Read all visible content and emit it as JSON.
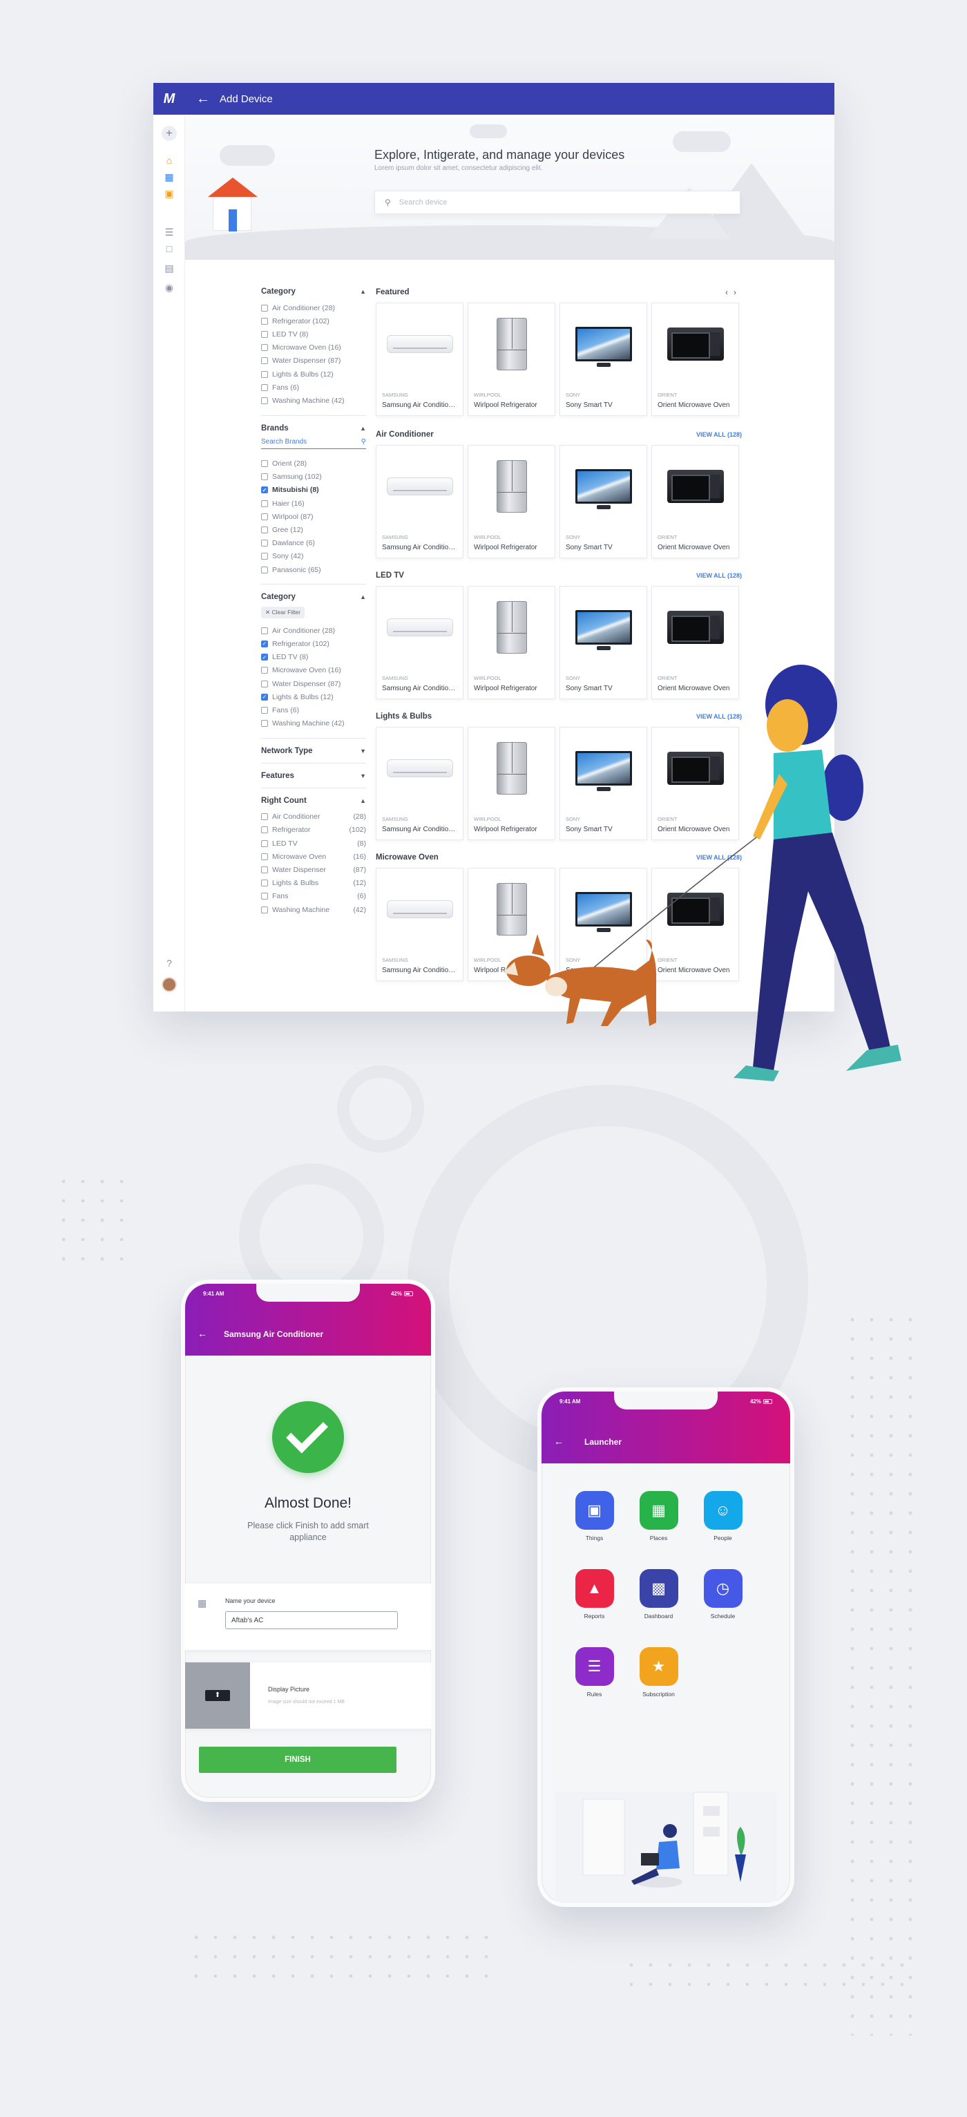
{
  "colors": {
    "primary": "#3a3fb0",
    "accent_blue": "#3b7ee8",
    "mobile_gradient_start": "#8b1eb7",
    "mobile_gradient_end": "#d4117a",
    "success": "#3bb54a"
  },
  "desktop": {
    "logo": "M",
    "title": "Add Device",
    "sidebar_icons": [
      "plus-icon",
      "home-icon",
      "devices-icon",
      "image-icon",
      "layers-icon",
      "calendar-icon",
      "document-icon",
      "globe-icon",
      "help-icon",
      "avatar"
    ],
    "hero": {
      "title": "Explore, Intigerate, and manage your devices",
      "subtitle": "Lorem ipsum dolor sit amet, consectetur adipiscing elit.",
      "search_placeholder": "Search device"
    },
    "filters": {
      "category1": {
        "title": "Category",
        "items": [
          "Air Conditioner (28)",
          "Refrigerator (102)",
          "LED TV (8)",
          "Microwave Oven (16)",
          "Water Dispenser (87)",
          "Lights & Bulbs (12)",
          "Fans (6)",
          "Washing Machine (42)"
        ]
      },
      "brands": {
        "title": "Brands",
        "search_placeholder": "Search Brands",
        "items": [
          "Orient (28)",
          "Samsung (102)",
          "Mitsubishi (8)",
          "Haier (16)",
          "Wirlpool (87)",
          "Gree (12)",
          "Dawlance (6)",
          "Sony (42)",
          "Panasonic (65)"
        ]
      },
      "category2": {
        "title": "Category",
        "clear_filter": "Clear Filter",
        "items": [
          "Air Conditioner (28)",
          "Refrigerator (102)",
          "LED TV (8)",
          "Microwave Oven (16)",
          "Water Dispenser (87)",
          "Lights & Bulbs (12)",
          "Fans (6)",
          "Washing Machine (42)"
        ]
      },
      "network_type": "Network Type",
      "features": "Features",
      "right_count": {
        "title": "Right Count",
        "items": [
          {
            "label": "Air Conditioner",
            "count": "(28)"
          },
          {
            "label": "Refrigerator",
            "count": "(102)"
          },
          {
            "label": "LED TV",
            "count": "(8)"
          },
          {
            "label": "Microwave Oven",
            "count": "(16)"
          },
          {
            "label": "Water Dispenser",
            "count": "(87)"
          },
          {
            "label": "Lights & Bulbs",
            "count": "(12)"
          },
          {
            "label": "Fans",
            "count": "(6)"
          },
          {
            "label": "Washing Machine",
            "count": "(42)"
          }
        ]
      }
    },
    "products": {
      "view_all": "VIEW ALL (128)",
      "sections": [
        "Featured",
        "Air Conditioner",
        "LED TV",
        "Lights & Bulbs",
        "Microwave Oven"
      ],
      "cards": [
        {
          "brand": "SAMSUNG",
          "name": "Samsung Air Conditioner"
        },
        {
          "brand": "WIRLPOOL",
          "name": "Wirlpool Refrigerator"
        },
        {
          "brand": "SONY",
          "name": "Sony Smart TV"
        },
        {
          "brand": "ORIENT",
          "name": "Orient Microwave Oven"
        }
      ]
    }
  },
  "phone1": {
    "time": "9:41 AM",
    "battery": "42%",
    "title": "Samsung Air Conditioner",
    "heading": "Almost Done!",
    "message": "Please click Finish to add smart appliance",
    "name_label": "Name your device",
    "name_value": "Aftab's AC",
    "picture_label": "Display Picture",
    "picture_hint": "Image size should not exceed 1 MB",
    "finish": "FINISH"
  },
  "phone2": {
    "time": "9:41 AM",
    "battery": "42%",
    "title": "Launcher",
    "apps": [
      {
        "label": "Things",
        "icon": "cube-icon",
        "color": "#3f62e8"
      },
      {
        "label": "Places",
        "icon": "building-icon",
        "color": "#27b24a"
      },
      {
        "label": "People",
        "icon": "people-icon",
        "color": "#12a8ea"
      },
      {
        "label": "Reports",
        "icon": "chart-icon",
        "color": "#ea2546"
      },
      {
        "label": "Dashboard",
        "icon": "dashboard-icon",
        "color": "#3a43a8"
      },
      {
        "label": "Schedule",
        "icon": "calendar-clock-icon",
        "color": "#4659e6"
      },
      {
        "label": "Rules",
        "icon": "list-icon",
        "color": "#8e2cc9"
      },
      {
        "label": "Subscription",
        "icon": "medal-icon",
        "color": "#f3a41e"
      }
    ]
  }
}
